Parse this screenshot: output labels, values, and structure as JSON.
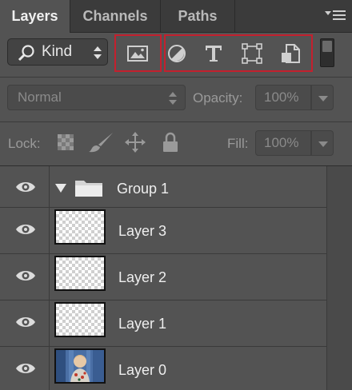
{
  "tabs": [
    {
      "label": "Layers",
      "active": true
    },
    {
      "label": "Channels",
      "active": false
    },
    {
      "label": "Paths",
      "active": false
    }
  ],
  "filter": {
    "kind_label": "Kind",
    "icons": [
      "pixel-layer-filter-icon",
      "adjustment-layer-filter-icon",
      "type-layer-filter-icon",
      "shape-layer-filter-icon",
      "smart-object-filter-icon"
    ]
  },
  "blend": {
    "mode": "Normal",
    "opacity_label": "Opacity:",
    "opacity_value": "100%"
  },
  "lock": {
    "label": "Lock:",
    "icons": [
      "lock-transparent-pixels-icon",
      "lock-image-pixels-icon",
      "lock-position-icon",
      "lock-all-icon"
    ],
    "fill_label": "Fill:",
    "fill_value": "100%"
  },
  "layers": [
    {
      "name": "Group 1",
      "type": "group",
      "visible": true,
      "expanded": true
    },
    {
      "name": "Layer 3",
      "type": "pixel",
      "visible": true
    },
    {
      "name": "Layer 2",
      "type": "pixel",
      "visible": true
    },
    {
      "name": "Layer 1",
      "type": "pixel",
      "visible": true
    },
    {
      "name": "Layer 0",
      "type": "photo",
      "visible": true
    }
  ],
  "colors": {
    "highlight": "#c4202e",
    "panel": "#535353",
    "tabbar": "#3b3b3b"
  }
}
